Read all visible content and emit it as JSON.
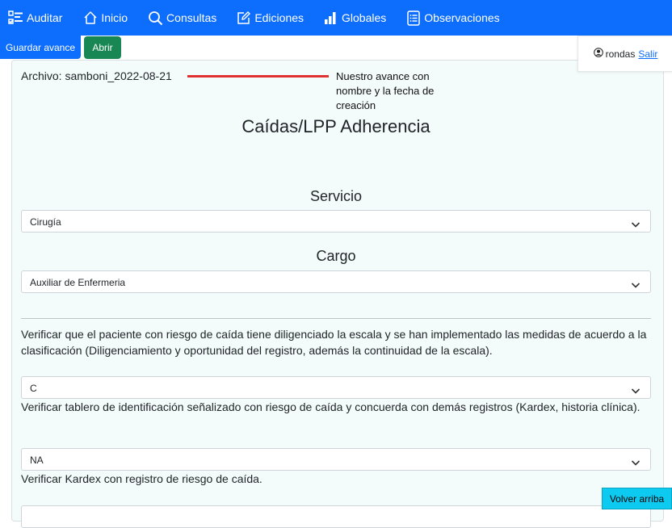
{
  "nav": {
    "items": [
      {
        "label": "Auditar",
        "icon": "checklist-icon"
      },
      {
        "label": "Inicio",
        "icon": "house-icon"
      },
      {
        "label": "Consultas",
        "icon": "search-icon"
      },
      {
        "label": "Ediciones",
        "icon": "edit-icon"
      },
      {
        "label": "Globales",
        "icon": "bar-chart-icon"
      },
      {
        "label": "Observaciones",
        "icon": "list-document-icon"
      }
    ]
  },
  "toolbar": {
    "save_label": "Guardar avance",
    "open_label": "Abrir"
  },
  "user": {
    "name": "rondas",
    "logout_label": "Salir"
  },
  "file": {
    "label": "Archivo: samboni_2022-08-21"
  },
  "annotation": "Nuestro avance con nombre y la fecha de creación",
  "form": {
    "title": "Caídas/LPP Adherencia",
    "service_label": "Servicio",
    "service_value": "Cirugía",
    "role_label": "Cargo",
    "role_value": "Auxiliar de Enfermeria",
    "questions": [
      {
        "text": "Verificar que el paciente con riesgo de caída tiene diligenciado la escala y se han implementado las medidas de acuerdo a la clasificación (Diligenciamiento y oportunidad del registro, además la continuidad de la escala).",
        "answer": "C"
      },
      {
        "text": "Verificar tablero de identificación señalizado con riesgo de caída y concuerda con demás registros (Kardex, historia clínica).",
        "answer": "NA"
      },
      {
        "text": "Verificar Kardex con registro de riesgo de caída.",
        "answer": ""
      }
    ]
  },
  "back_to_top_label": "Volver arriba",
  "colors": {
    "primary": "#0d6efd",
    "success": "#198754",
    "info": "#0dcaf0",
    "annotation_line": "#e03030"
  }
}
